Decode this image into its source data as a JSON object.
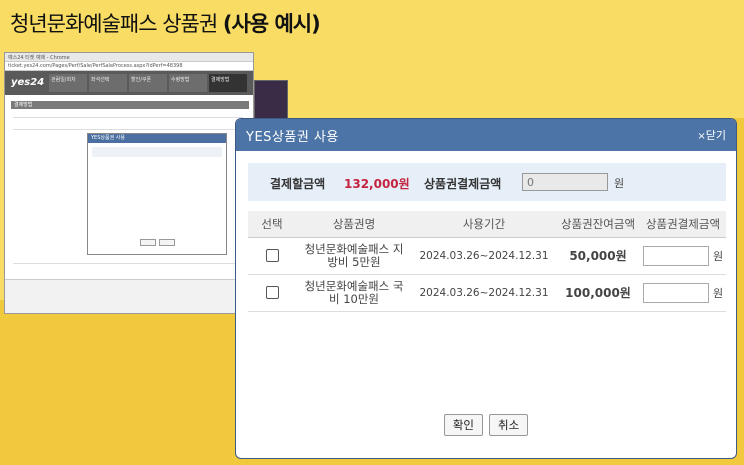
{
  "page": {
    "title_prefix": "청년문화예술패스 상품권",
    "title_emphasis": "(사용 예시)"
  },
  "background_window": {
    "title": "예스24 티켓 예매 - Chrome",
    "address": "ticket.yes24.com/Pages/Perf/Sale/PerfSaleProcess.aspx?IdPerf=48398",
    "logo": "yes24",
    "steps": [
      "관람일/회차",
      "좌석선택",
      "할인/쿠폰",
      "수령방법",
      "결제방법"
    ],
    "section": "결제방법",
    "mini_dialog_title": "YES상품권 사용"
  },
  "dialog": {
    "title": "YES상품권 사용",
    "close_label": "닫기",
    "summary": {
      "payment_label": "결제할금액",
      "payment_amount": "132,000원",
      "voucher_label": "상품권결제금액",
      "voucher_value": "0",
      "unit": "원"
    },
    "columns": [
      "선택",
      "상품권명",
      "사용기간",
      "상품권잔여금액",
      "상품권결제금액"
    ],
    "rows": [
      {
        "name": "청년문화예술패스 지방비 5만원",
        "period": "2024.03.26~2024.12.31",
        "balance": "50,000원",
        "unit": "원"
      },
      {
        "name": "청년문화예술패스 국비 10만원",
        "period": "2024.03.26~2024.12.31",
        "balance": "100,000원",
        "unit": "원"
      }
    ],
    "confirm_label": "확인",
    "cancel_label": "취소"
  },
  "colors": {
    "background": "#f8dc63",
    "header": "#4d74a6",
    "accent_red": "#c4243f"
  }
}
